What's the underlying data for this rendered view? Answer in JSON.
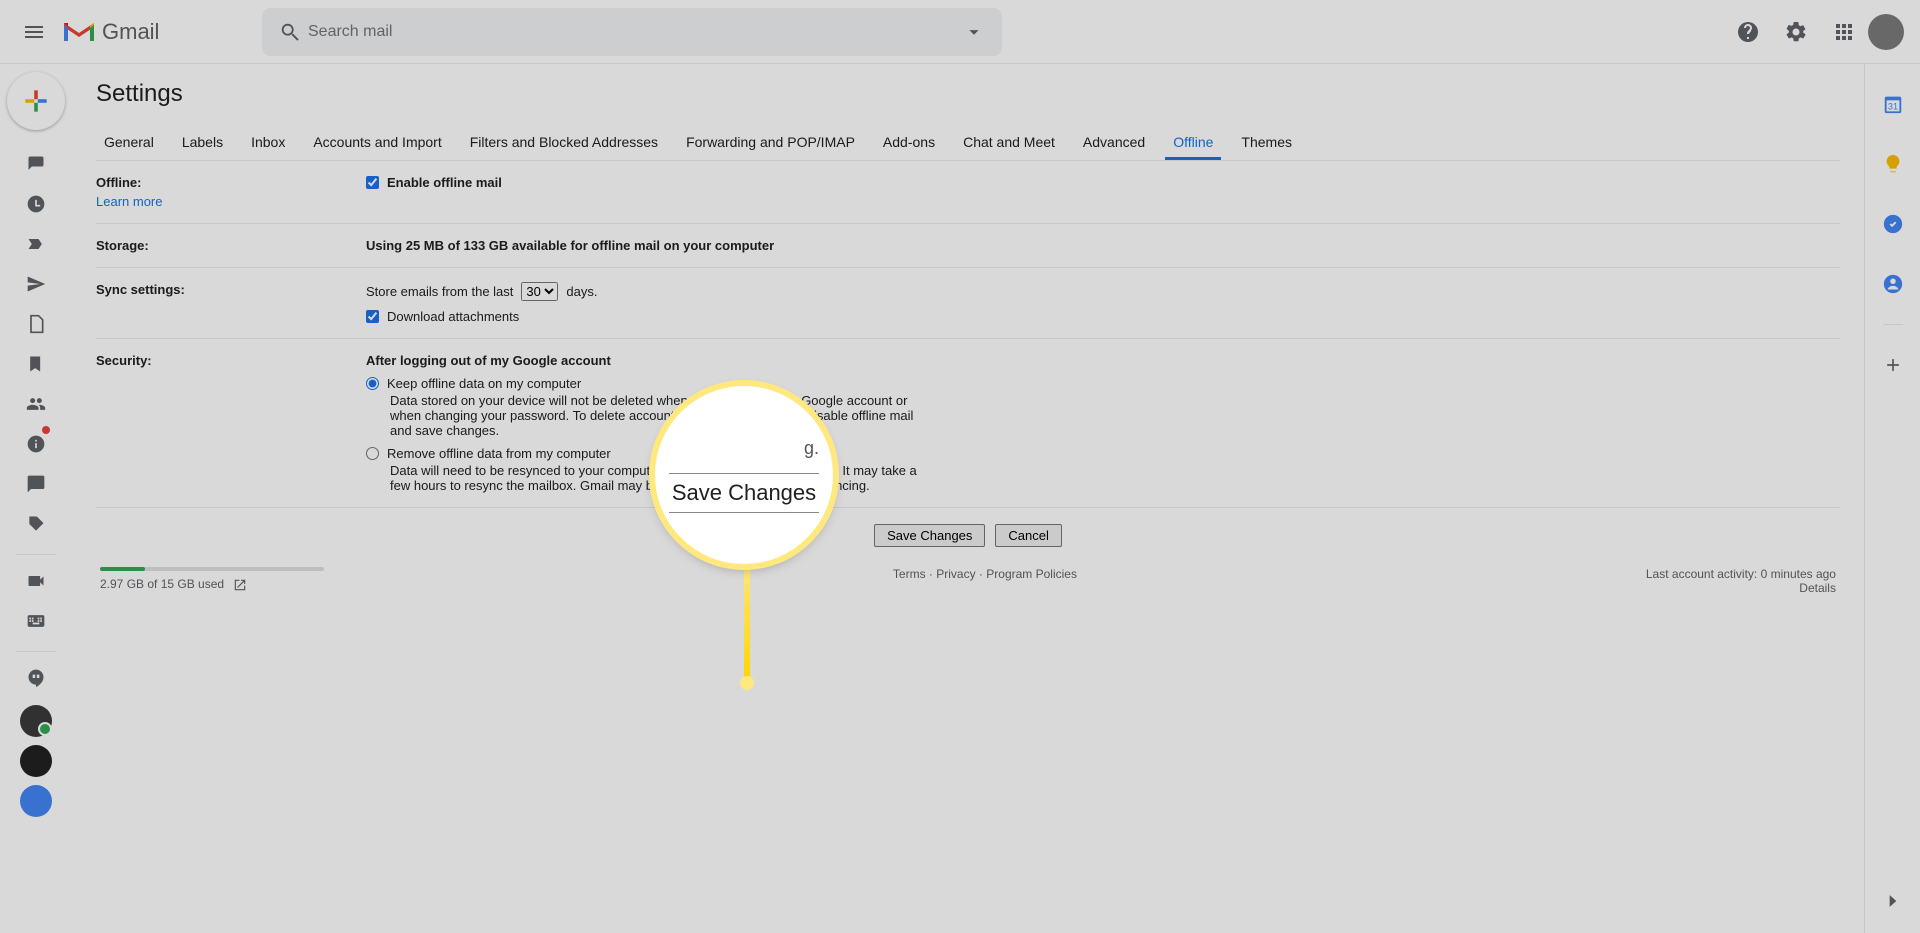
{
  "header": {
    "search_placeholder": "Search mail",
    "logo_text": "Gmail"
  },
  "page_title": "Settings",
  "tabs": [
    "General",
    "Labels",
    "Inbox",
    "Accounts and Import",
    "Filters and Blocked Addresses",
    "Forwarding and POP/IMAP",
    "Add-ons",
    "Chat and Meet",
    "Advanced",
    "Offline",
    "Themes"
  ],
  "active_tab_index": 9,
  "offline": {
    "section_label": "Offline:",
    "learn_more": "Learn more",
    "enable_label": "Enable offline mail",
    "enable_checked": true
  },
  "storage": {
    "section_label": "Storage:",
    "text": "Using 25 MB of 133 GB available for offline mail on your computer"
  },
  "sync": {
    "section_label": "Sync settings:",
    "store_prefix": "Store emails from the last",
    "store_suffix": "days.",
    "days_value": "30",
    "download_label": "Download attachments",
    "download_checked": true
  },
  "security": {
    "section_label": "Security:",
    "heading": "After logging out of my Google account",
    "opt1_label": "Keep offline data on my computer",
    "opt1_desc": "Data stored on your device will not be deleted when signing out of your Google account or when changing your password. To delete account data from your device disable offline mail and save changes.",
    "opt2_label": "Remove offline data from my computer",
    "opt2_desc": "Data will need to be resynced to your computer when logging back into Gmail. It may take a few hours to resync the mailbox. Gmail may become less responsive while syncing.",
    "selected": "keep"
  },
  "buttons": {
    "save": "Save Changes",
    "cancel": "Cancel"
  },
  "footer": {
    "storage_used": "2.97 GB of 15 GB used",
    "storage_pct": 20,
    "terms": "Terms",
    "privacy": "Privacy",
    "policies": "Program Policies",
    "activity": "Last account activity: 0 minutes ago",
    "details": "Details"
  },
  "magnifier": {
    "top_fragment": "g.",
    "button_text": "Save Changes"
  }
}
